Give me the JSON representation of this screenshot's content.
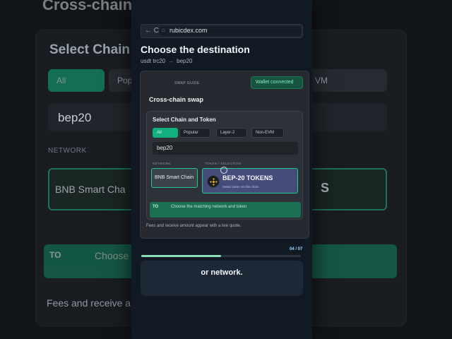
{
  "background": {
    "title": "Cross-chain",
    "heading": "Select Chain",
    "filter_all": "All",
    "filter_popular": "Pop",
    "filter_nonevm": "VM",
    "search_value": "bep20",
    "network_label": "NETWORK",
    "network_value": "BNB Smart Cha",
    "token_fragment": "S",
    "to_label": "TO",
    "to_text": "Choose",
    "fees_text": "Fees and receive a"
  },
  "browser": {
    "nav": "← C",
    "url": "rubicdex.com"
  },
  "page": {
    "title": "Choose the destination",
    "from_token": "usdt trc20",
    "arrow": "→",
    "to_token": "bep20"
  },
  "card": {
    "swap_guide": "SWAP GUIDE",
    "wallet": "Wallet connected",
    "title": "Cross-chain swap",
    "inner": {
      "title": "Select Chain and Token",
      "filters": [
        "All",
        "Popular",
        "Layer-2",
        "Non-EVM"
      ],
      "search_value": "bep20",
      "network_label": "NETWORK",
      "token_label": "TOKEN / SELECTION",
      "network_button": "BNB Smart Chain",
      "token_name": "BEP-20 TOKENS",
      "token_sub": "Select token on this chain",
      "to_label": "TO",
      "to_text": "Choose the matching network and token"
    },
    "fees": "Fees and receive amount appear with a live quote."
  },
  "progress": {
    "value": 0.5,
    "step": "04 / 07"
  },
  "caption": "or network.",
  "colors": {
    "accent": "#14b07f",
    "token_card": "#454c7a"
  }
}
